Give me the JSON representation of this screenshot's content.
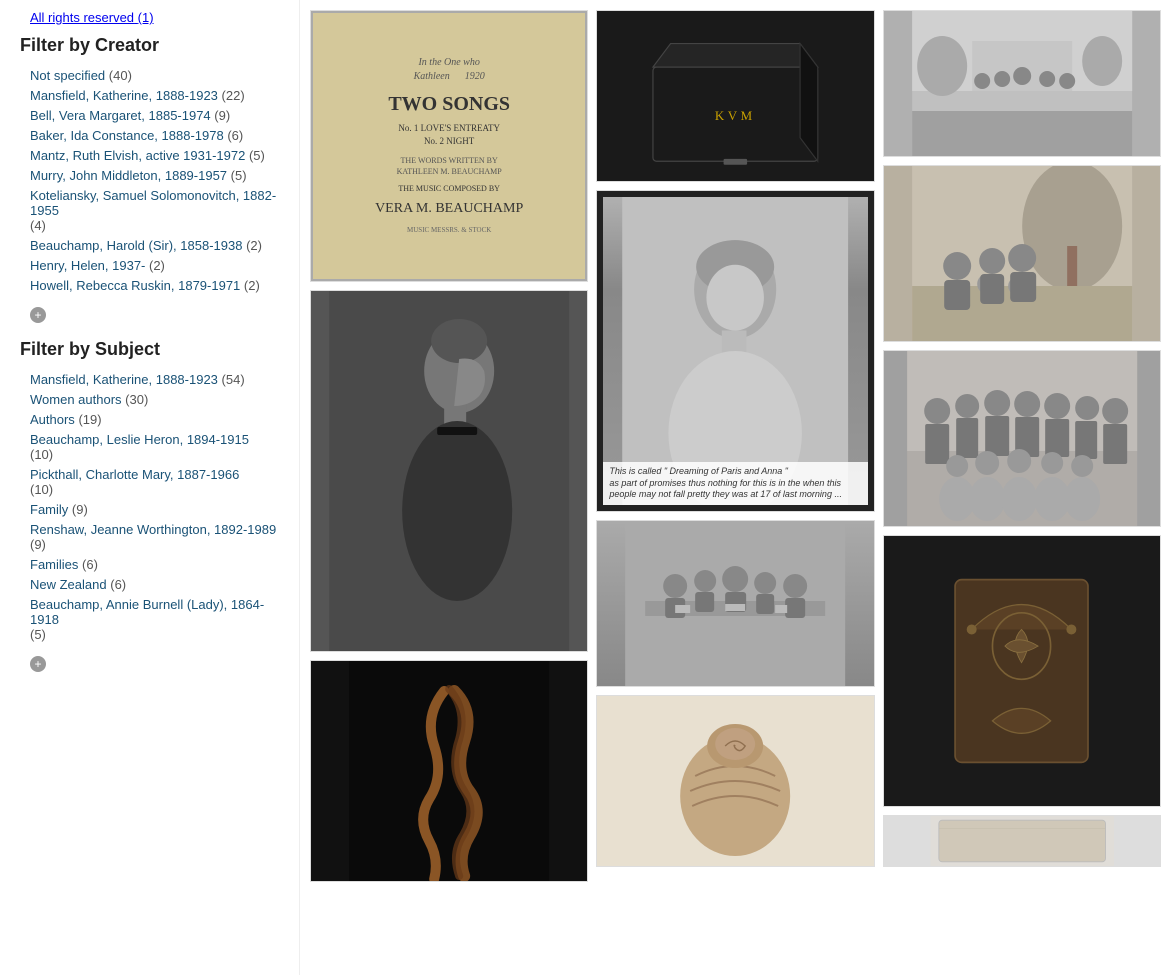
{
  "sidebar": {
    "all_rights": "All rights reserved",
    "all_rights_count": "(1)",
    "filter_creator_title": "Filter by Creator",
    "creator_items": [
      {
        "label": "Not specified",
        "count": "(40)"
      },
      {
        "label": "Mansfield, Katherine, 1888-1923",
        "count": "(22)"
      },
      {
        "label": "Bell, Vera Margaret, 1885-1974",
        "count": "(9)"
      },
      {
        "label": "Baker, Ida Constance, 1888-1978",
        "count": "(6)"
      },
      {
        "label": "Mantz, Ruth Elvish, active 1931-1972",
        "count": "(5)"
      },
      {
        "label": "Murry, John Middleton, 1889-1957",
        "count": "(5)"
      },
      {
        "label": "Koteliansky, Samuel Solomonovitch, 1882-1955",
        "count": "(4)"
      },
      {
        "label": "Beauchamp, Harold (Sir), 1858-1938",
        "count": "(2)"
      },
      {
        "label": "Henry, Helen, 1937-",
        "count": "(2)"
      },
      {
        "label": "Howell, Rebecca Ruskin, 1879-1971",
        "count": "(2)"
      }
    ],
    "filter_subject_title": "Filter by Subject",
    "subject_items": [
      {
        "label": "Mansfield, Katherine, 1888-1923",
        "count": "(54)"
      },
      {
        "label": "Women authors",
        "count": "(30)"
      },
      {
        "label": "Authors",
        "count": "(19)"
      },
      {
        "label": "Beauchamp, Leslie Heron, 1894-1915",
        "count": "(10)"
      },
      {
        "label": "Pickthall, Charlotte Mary, 1887-1966",
        "count": "(10)"
      },
      {
        "label": "Family",
        "count": "(9)"
      },
      {
        "label": "Renshaw, Jeanne Worthington, 1892-1989",
        "count": "(9)"
      },
      {
        "label": "Families",
        "count": "(6)"
      },
      {
        "label": "New Zealand",
        "count": "(6)"
      },
      {
        "label": "Beauchamp, Annie Burnell (Lady), 1864-1918",
        "count": "(5)"
      }
    ]
  },
  "images": {
    "col1": [
      {
        "id": "book",
        "caption": "TWO SONGS / No.1 LOVE'S ENTREATY / No.2 NIGHT / VERA M. BEAUCHAMP"
      },
      {
        "id": "portrait-side",
        "caption": ""
      },
      {
        "id": "hair-dark",
        "caption": ""
      }
    ],
    "col2": [
      {
        "id": "black-box",
        "caption": "KVM"
      },
      {
        "id": "portrait-bw",
        "caption": "This is called 'Dreaming of Paris and Anna' ..."
      },
      {
        "id": "meeting",
        "caption": ""
      },
      {
        "id": "hair-brown",
        "caption": ""
      }
    ],
    "col3": [
      {
        "id": "group-outdoor",
        "caption": ""
      },
      {
        "id": "group-family",
        "caption": ""
      },
      {
        "id": "group-large",
        "caption": ""
      },
      {
        "id": "ornament",
        "caption": ""
      },
      {
        "id": "artifact",
        "caption": ""
      }
    ]
  }
}
